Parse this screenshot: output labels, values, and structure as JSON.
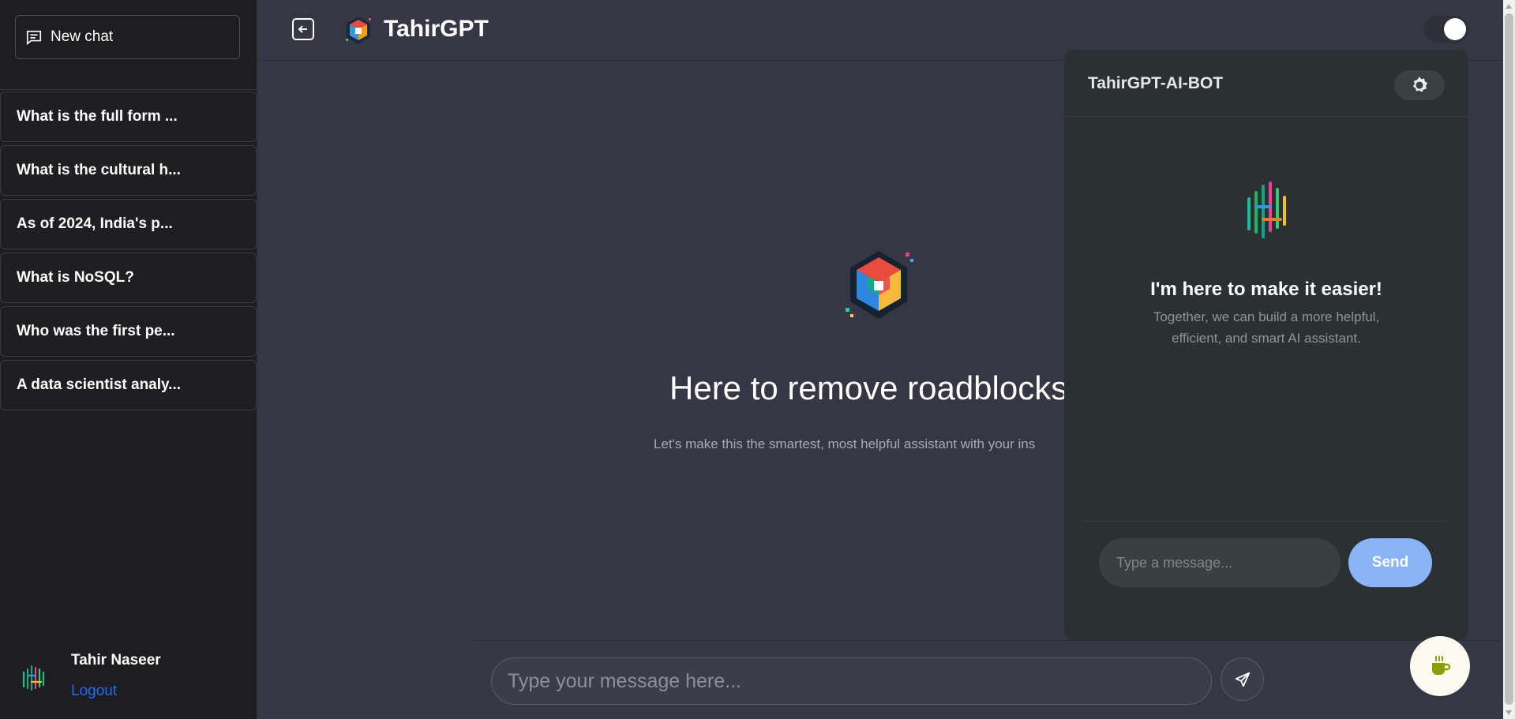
{
  "sidebar": {
    "new_chat_label": "New chat",
    "history": [
      "What is the full form ...",
      "What is the cultural h...",
      "As of 2024, India's p...",
      "What is NoSQL?",
      "Who was the first pe...",
      "A data scientist analy..."
    ],
    "user": {
      "name": "Tahir Naseer",
      "logout_label": "Logout"
    }
  },
  "header": {
    "title": "TahirGPT"
  },
  "main": {
    "hero_title": "Here to remove roadblocks",
    "hero_subtitle": "Let's make this the smartest, most helpful assistant with your ins",
    "input_placeholder": "Type your message here..."
  },
  "bot": {
    "title": "TahirGPT-AI-BOT",
    "heading": "I'm here to make it easier!",
    "description": "Together, we can build a more helpful, efficient, and smart AI assistant.",
    "input_placeholder": "Type a message...",
    "send_label": "Send"
  },
  "colors": {
    "background": "#363644",
    "sidebar": "#1e1e21",
    "link": "#1e6bff",
    "bot_send": "#8ab4f8",
    "fab": "#fbfbf0"
  },
  "icons": [
    "chat-icon",
    "back-arrow-icon",
    "brand-logo-icon",
    "send-plane-icon",
    "gear-icon",
    "coffee-icon"
  ]
}
